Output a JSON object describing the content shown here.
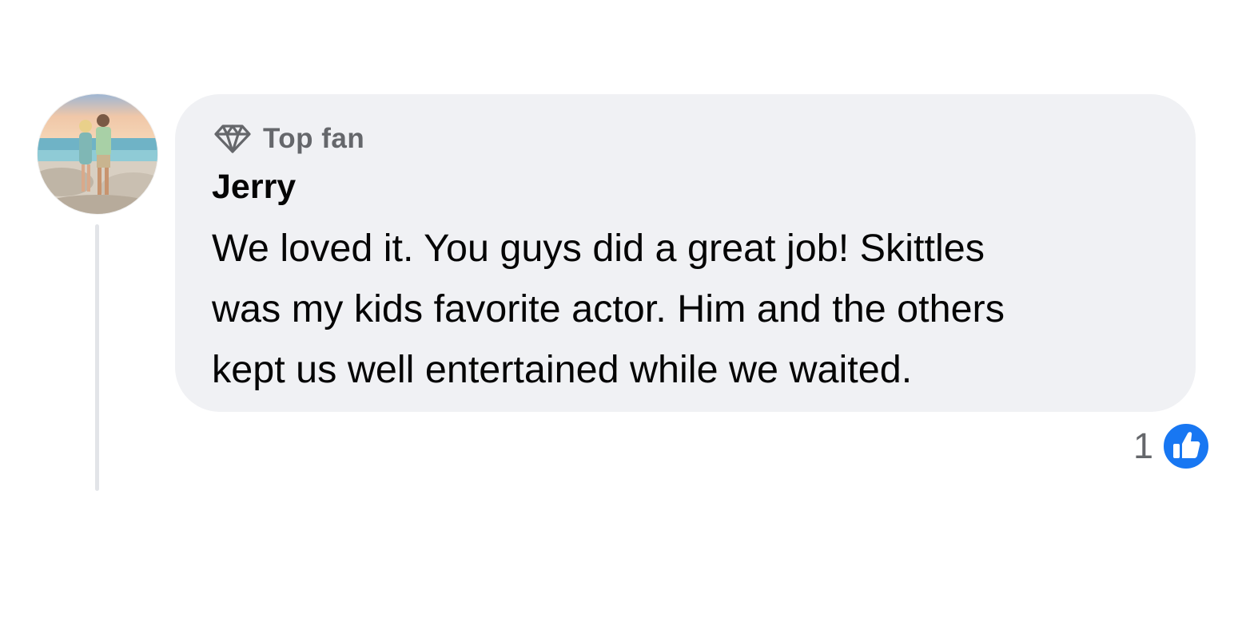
{
  "comment": {
    "badge": "Top fan",
    "badge_icon": "diamond-icon",
    "author": "Jerry",
    "lines": [
      "We loved it. You guys did a great job! Skittles",
      "was my kids favorite actor. Him and the others",
      "kept us well entertained while we waited."
    ],
    "reaction_count": "1",
    "reaction_icon": "like-icon",
    "colors": {
      "bubble": "#f0f1f4",
      "like": "#1877f2",
      "secondary_text": "#65676b",
      "thread_line": "#e2e4e8"
    }
  }
}
